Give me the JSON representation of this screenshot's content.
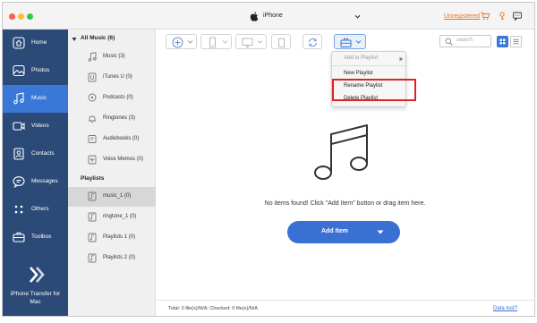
{
  "titlebar": {
    "device_name": "iPhone",
    "unregistered_label": "Unregistered"
  },
  "nav": {
    "items": [
      {
        "label": "Home",
        "icon": "home-icon"
      },
      {
        "label": "Photos",
        "icon": "photos-icon"
      },
      {
        "label": "Music",
        "icon": "music-icon",
        "active": true
      },
      {
        "label": "Videos",
        "icon": "videos-icon"
      },
      {
        "label": "Contacts",
        "icon": "contacts-icon"
      },
      {
        "label": "Messages",
        "icon": "messages-icon"
      },
      {
        "label": "Others",
        "icon": "others-icon"
      },
      {
        "label": "Toolbox",
        "icon": "toolbox-icon"
      }
    ],
    "brand": [
      "iPhone Transfer for",
      "Mac"
    ]
  },
  "library": {
    "all_music": "All Music (6)",
    "items": [
      {
        "label": "Music (3)",
        "icon": "music-note-icon"
      },
      {
        "label": "iTunes U (0)",
        "icon": "itunes-u-icon"
      },
      {
        "label": "Podcasts (0)",
        "icon": "podcast-icon"
      },
      {
        "label": "Ringtones (3)",
        "icon": "bell-icon"
      },
      {
        "label": "Audiobooks (0)",
        "icon": "audiobook-icon"
      },
      {
        "label": "Voice Memos (0)",
        "icon": "voice-memo-icon"
      }
    ],
    "playlists_heading": "Playlists",
    "playlists": [
      {
        "label": "music_1 (0)",
        "selected": true
      },
      {
        "label": "ringtone_1 (0)"
      },
      {
        "label": "Playlists 1 (0)"
      },
      {
        "label": "Playlists 2 (0)"
      }
    ]
  },
  "toolbar": {
    "search_placeholder": "search"
  },
  "dropdown": {
    "items": [
      {
        "label": "Add to Playlist",
        "disabled": true,
        "submenu": true
      },
      {
        "label": "New Playlist"
      },
      {
        "label": "Rename Playlist"
      },
      {
        "label": "Delete Playlist"
      }
    ],
    "highlight_color": "#e02222"
  },
  "main": {
    "empty_message": "No items found! Click \"Add Item\" button or drag item here.",
    "add_item_label": "Add Item"
  },
  "status": {
    "summary": "Total: 0 file(s)/N/A; Checked: 0 file(s)/N/A",
    "data_lost_link": "Data lost?"
  },
  "colors": {
    "nav_background": "#2c4a78",
    "accent": "#3a78d8",
    "unregistered": "#e8731d"
  }
}
